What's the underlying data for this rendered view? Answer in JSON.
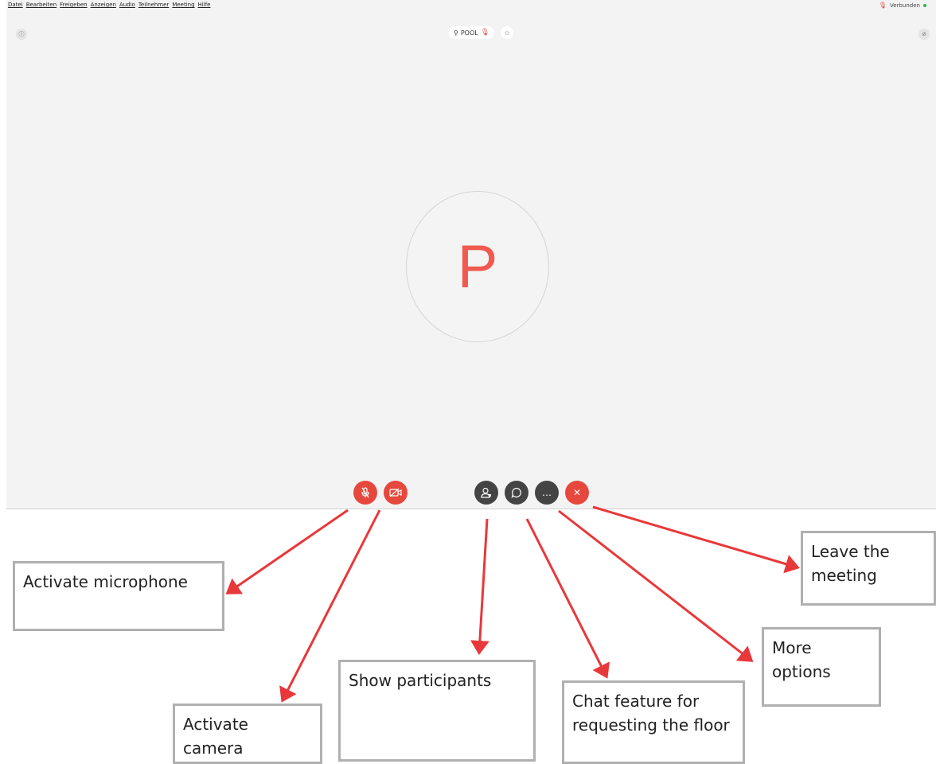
{
  "menubar": {
    "items": [
      "Datei",
      "Bearbeiten",
      "Freigeben",
      "Anzeigen",
      "Audio",
      "Teilnehmer",
      "Meeting",
      "Hilfe"
    ],
    "status": "Verbunden"
  },
  "meeting": {
    "room_name": "POOL",
    "avatar_letter": "P"
  },
  "controls": {
    "mute": "mic-off-icon",
    "video": "video-off-icon",
    "participants": "participants-icon",
    "chat": "chat-icon",
    "more": "…",
    "leave": "✕"
  },
  "annotations": {
    "microphone": "Activate microphone",
    "camera": "Activate camera",
    "participants": "Show participants",
    "chat": "Chat feature for requesting the floor",
    "more": "More options",
    "leave": "Leave the meeting"
  },
  "colors": {
    "control_red": "#e6483d",
    "control_dark": "#444444",
    "arrow": "#e8383a",
    "avatar_letter": "#f05a50"
  }
}
